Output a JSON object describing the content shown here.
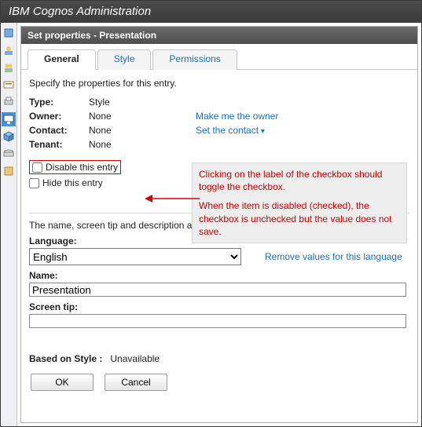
{
  "app_title": "IBM Cognos Administration",
  "dialog_title": "Set properties - Presentation",
  "tabs": {
    "general": "General",
    "style": "Style",
    "permissions": "Permissions"
  },
  "intro": "Specify the properties for this entry.",
  "props": {
    "type_label": "Type:",
    "type_value": "Style",
    "owner_label": "Owner:",
    "owner_value": "None",
    "contact_label": "Contact:",
    "contact_value": "None",
    "tenant_label": "Tenant:",
    "tenant_value": "None"
  },
  "links": {
    "make_owner": "Make me the owner",
    "set_contact": "Set the contact",
    "remove_values": "Remove values for this language"
  },
  "checks": {
    "disable": "Disable this entry",
    "hide": "Hide this entry"
  },
  "annotation": {
    "p1": "Clicking on the label of the checkbox should toggle the checkbox.",
    "p2": "When the item is disabled (checked), the checkbox is unchecked but the value does not save."
  },
  "note": "The name, screen tip and description are shown for the selected language.",
  "language": {
    "label": "Language:",
    "value": "English",
    "options": [
      "English"
    ]
  },
  "name": {
    "label": "Name:",
    "value": "Presentation"
  },
  "screen_tip": {
    "label": "Screen tip:",
    "value": ""
  },
  "based_on": {
    "label": "Based on Style :",
    "value": "Unavailable"
  },
  "buttons": {
    "ok": "OK",
    "cancel": "Cancel"
  },
  "sidebar_icons": [
    "security-icon",
    "users-icon",
    "groups-icon",
    "config-icon",
    "printer-icon",
    "monitor-icon",
    "cube-icon",
    "disk-icon",
    "data-icon"
  ]
}
